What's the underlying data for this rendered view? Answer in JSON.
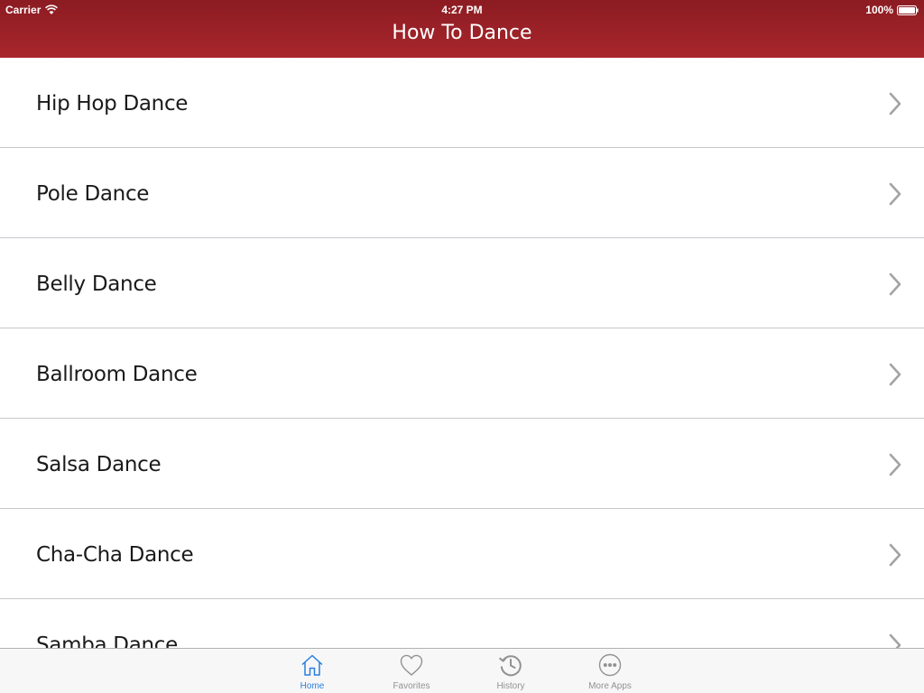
{
  "status_bar": {
    "carrier": "Carrier",
    "time": "4:27 PM",
    "battery": "100%"
  },
  "nav": {
    "title": "How To Dance"
  },
  "list": {
    "items": [
      {
        "label": "Hip Hop Dance"
      },
      {
        "label": "Pole Dance"
      },
      {
        "label": "Belly Dance"
      },
      {
        "label": "Ballroom Dance"
      },
      {
        "label": "Salsa Dance"
      },
      {
        "label": "Cha-Cha Dance"
      },
      {
        "label": "Samba Dance"
      }
    ]
  },
  "tab_bar": {
    "tabs": [
      {
        "label": "Home",
        "icon": "home-icon",
        "active": true
      },
      {
        "label": "Favorites",
        "icon": "heart-icon",
        "active": false
      },
      {
        "label": "History",
        "icon": "history-icon",
        "active": false
      },
      {
        "label": "More Apps",
        "icon": "more-icon",
        "active": false
      }
    ]
  },
  "colors": {
    "header": "#a8262c",
    "active_tab": "#2a7fdc",
    "inactive_tab": "#929292"
  }
}
